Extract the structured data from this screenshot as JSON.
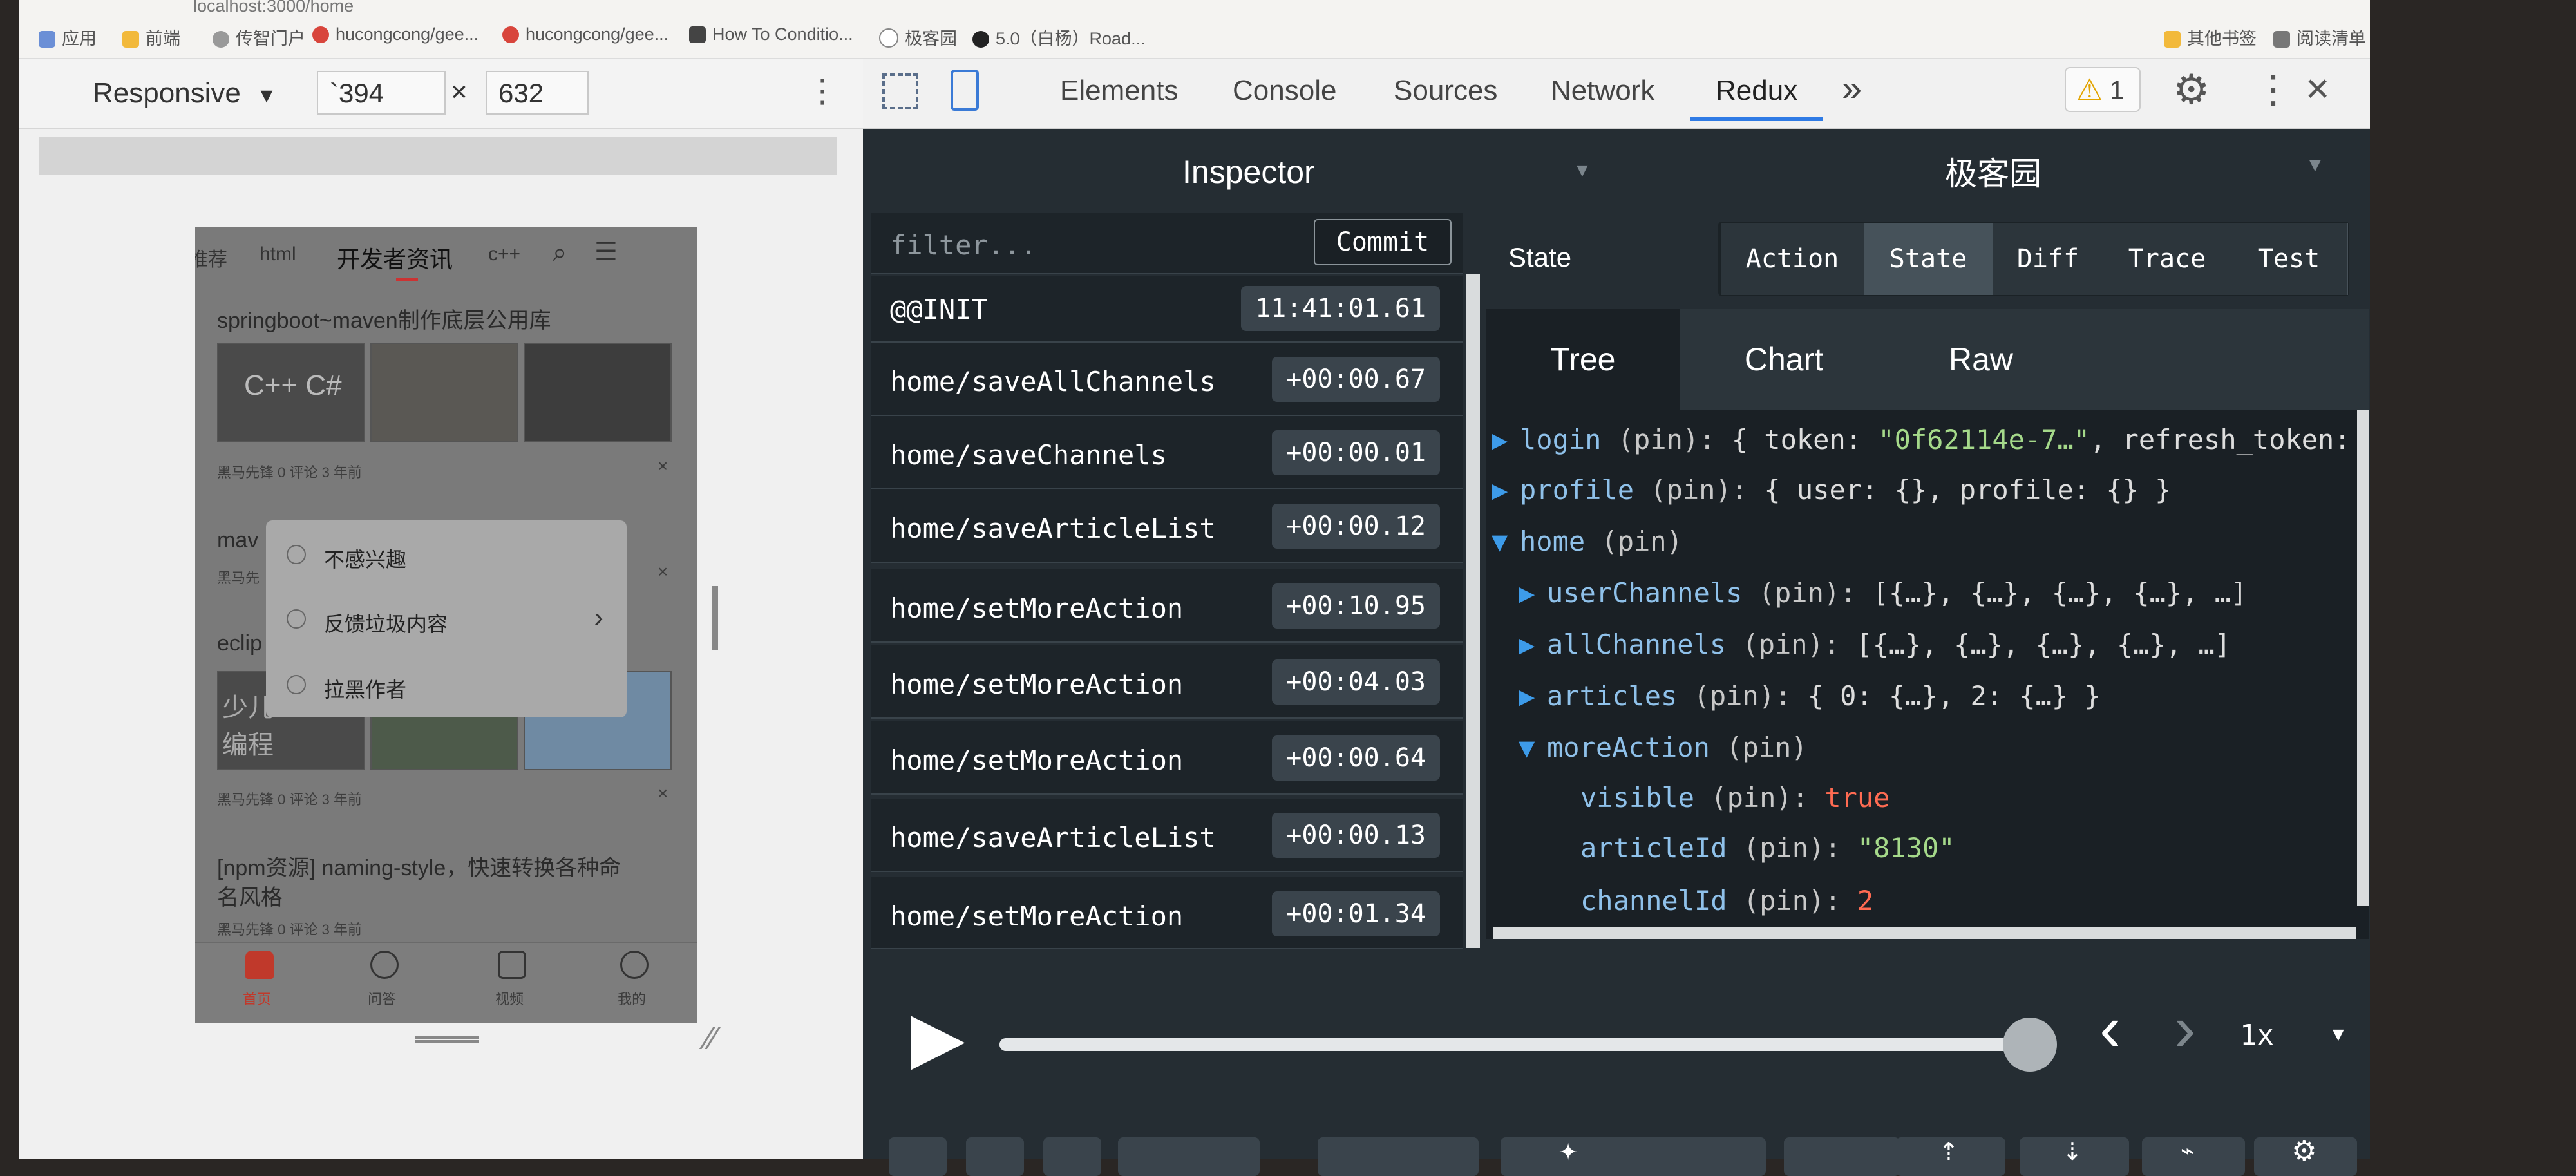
{
  "bookmarks": {
    "address": "localhost:3000/home",
    "items": [
      "应用",
      "前端",
      "传智门户",
      "hucongcong/gee...",
      "hucongcong/gee...",
      "How To Conditio...",
      "极客园",
      "5.0（白杨）Road...",
      "其他书签",
      "阅读清单"
    ]
  },
  "device_toolbar": {
    "mode": "Responsive",
    "width": "`394",
    "times": "×",
    "height": "632"
  },
  "phone": {
    "tabs": [
      "推荐",
      "html",
      "开发者资讯",
      "c++"
    ],
    "articles": [
      {
        "title": "springboot~maven制作底层公用库",
        "meta": "黑马先锋   0 评论   3 年前"
      },
      {
        "title": "mav",
        "meta": "黑马先"
      },
      {
        "title": "eclip",
        "meta": "黑马先锋   0 评论   3 年前"
      },
      {
        "title": "[npm资源] naming-style，快速转换各种命",
        "title2": "名风格",
        "meta": "黑马先锋   0 评论   3 年前"
      }
    ],
    "thumb_text": "C++ C#",
    "thumb_text2": "少儿 编程",
    "menu": [
      "不感兴趣",
      "反馈垃圾内容",
      "拉黑作者"
    ],
    "nav": [
      "首页",
      "问答",
      "视频",
      "我的"
    ]
  },
  "devtools": {
    "tabs": [
      "Elements",
      "Console",
      "Sources",
      "Network",
      "Redux"
    ],
    "more": "»",
    "warning_count": "1"
  },
  "redux": {
    "inspector_title": "Inspector",
    "instance_title": "极客园",
    "filter_placeholder": "filter...",
    "commit_label": "Commit",
    "actions": [
      {
        "name": "@@INIT",
        "time": "11:41:01.61"
      },
      {
        "name": "home/saveAllChannels",
        "time": "+00:00.67"
      },
      {
        "name": "home/saveChannels",
        "time": "+00:00.01"
      },
      {
        "name": "home/saveArticleList",
        "time": "+00:00.12"
      },
      {
        "name": "home/setMoreAction",
        "time": "+00:10.95"
      },
      {
        "name": "home/setMoreAction",
        "time": "+00:04.03"
      },
      {
        "name": "home/setMoreAction",
        "time": "+00:00.64"
      },
      {
        "name": "home/saveArticleList",
        "time": "+00:00.13"
      },
      {
        "name": "home/setMoreAction",
        "time": "+00:01.34"
      }
    ],
    "state_label": "State",
    "mode_tabs": [
      "Action",
      "State",
      "Diff",
      "Trace",
      "Test"
    ],
    "view_tabs": [
      "Tree",
      "Chart",
      "Raw"
    ],
    "speed": "1x",
    "tree": {
      "login_key": "login",
      "login_pin": " (pin): ",
      "login_val1": "{ token: ",
      "login_token": "\"0f62114e-7…\"",
      "login_val2": ", refresh_token:",
      "profile_key": "profile",
      "profile_pin": " (pin): ",
      "profile_val": "{ user: {}, profile: {} }",
      "home_key": "home",
      "home_pin": " (pin)",
      "uc_key": "userChannels",
      "uc_pin": " (pin): ",
      "uc_val": "[{…}, {…}, {…}, {…}, …]",
      "ac_key": "allChannels",
      "ac_pin": " (pin): ",
      "ac_val": "[{…}, {…}, {…}, {…}, …]",
      "ar_key": "articles",
      "ar_pin": " (pin): ",
      "ar_val": "{ 0: {…}, 2: {…} }",
      "ma_key": "moreAction",
      "ma_pin": " (pin)",
      "vis_key": "visible",
      "vis_pin": " (pin): ",
      "vis_val": "true",
      "aid_key": "articleId",
      "aid_pin": " (pin): ",
      "aid_val": "\"8130\"",
      "cid_key": "channelId",
      "cid_pin": " (pin): ",
      "cid_val": "2"
    }
  },
  "slider_progress": 1.0
}
